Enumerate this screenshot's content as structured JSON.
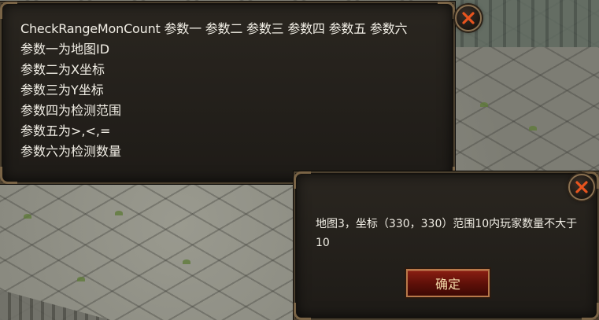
{
  "info_panel": {
    "lines": [
      "CheckRangeMonCount 参数一 参数二 参数三 参数四 参数五 参数六",
      "参数一为地图ID",
      "参数二为X坐标",
      "参数三为Y坐标",
      "参数四为检测范围",
      "参数五为>,<,=",
      "参数六为检测数量"
    ],
    "close_icon": "close-x-icon"
  },
  "dialog": {
    "message": "地图3，坐标（330，330）范围10内玩家数量不大于10",
    "confirm_label": "确定",
    "close_icon": "close-x-icon"
  },
  "colors": {
    "panel_bg": "#1e1b17",
    "panel_border": "#7a6446",
    "close_x": "#e8541e",
    "confirm_bg": "#6e150b",
    "confirm_text": "#f3d9a8",
    "text": "#f2efe6"
  }
}
